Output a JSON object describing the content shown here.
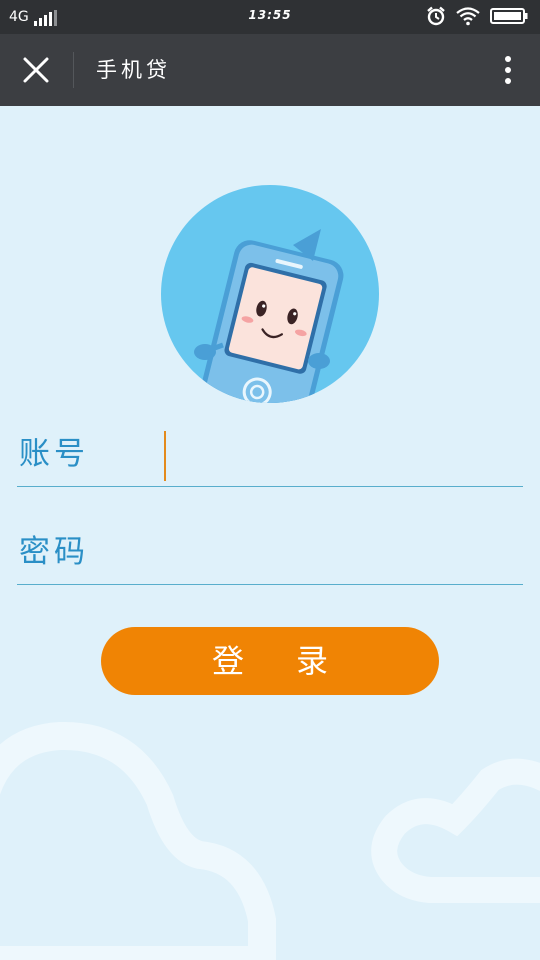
{
  "status_bar": {
    "network": "4G",
    "time": "13:55",
    "icons": [
      "signal-icon",
      "alarm-icon",
      "wifi-icon",
      "battery-icon"
    ]
  },
  "toolbar": {
    "title": "手机贷",
    "close_icon": "close-icon",
    "more_icon": "more-vertical-icon"
  },
  "login": {
    "account_label": "账号",
    "account_value": "",
    "password_label": "密码",
    "password_value": "",
    "submit_label": "登录"
  },
  "colors": {
    "status_bar_bg": "#2f3134",
    "toolbar_bg": "#3c3e42",
    "page_bg": "#dff1fa",
    "avatar_bg": "#66c7ef",
    "label_text": "#2a8fc6",
    "underline": "#58aecc",
    "button_bg": "#f08404",
    "caret": "#e38a1c"
  }
}
